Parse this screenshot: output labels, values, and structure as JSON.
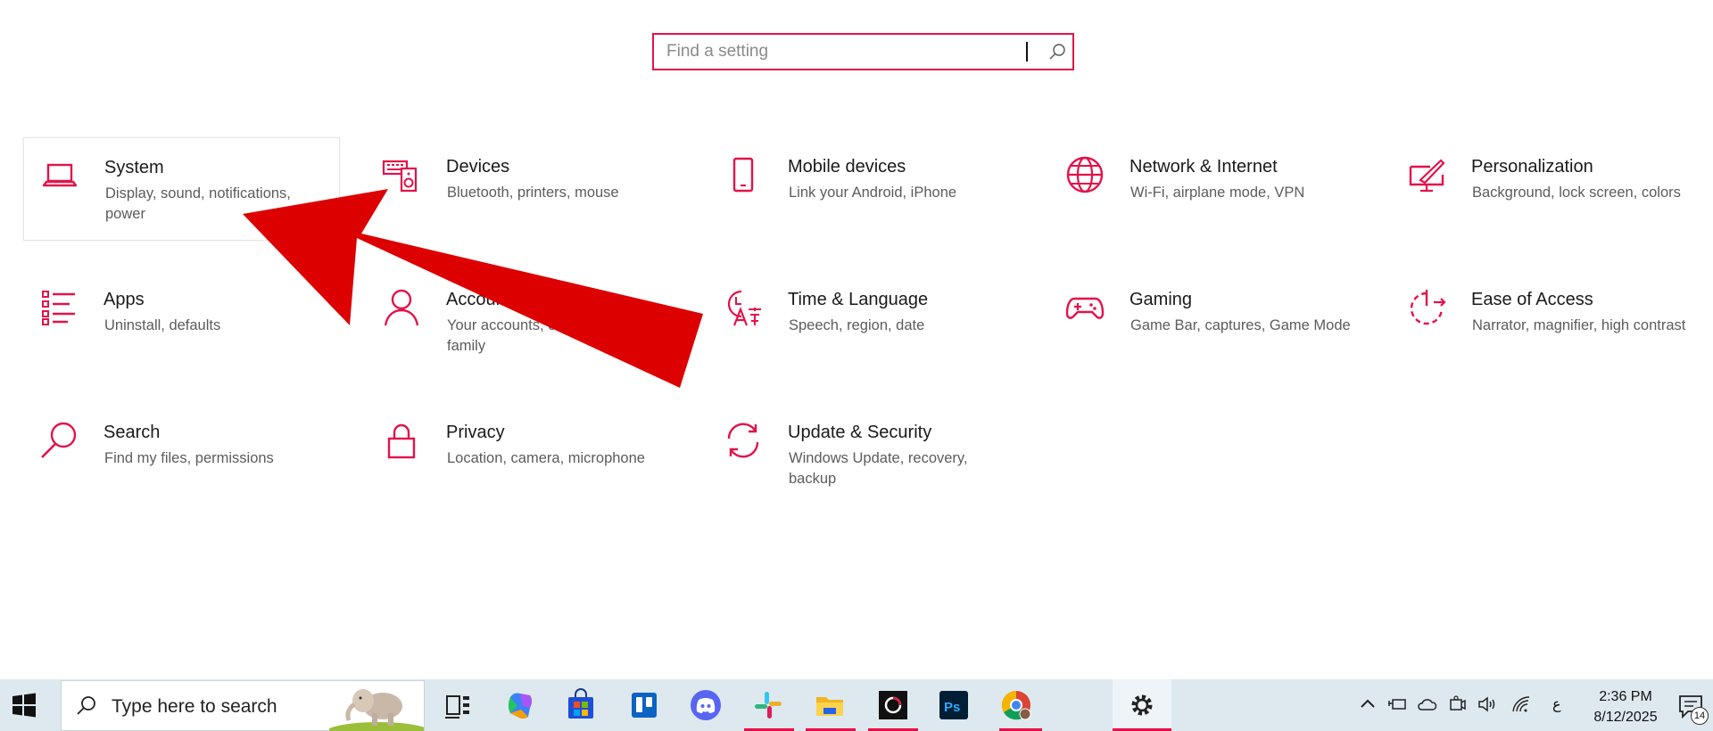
{
  "search": {
    "placeholder": "Find a setting",
    "value": ""
  },
  "categories": [
    {
      "title": "System",
      "desc": "Display, sound, notifications, power",
      "icon": "laptop-icon"
    },
    {
      "title": "Devices",
      "desc": "Bluetooth, printers, mouse",
      "icon": "devices-icon"
    },
    {
      "title": "Mobile devices",
      "desc": "Link your Android, iPhone",
      "icon": "phone-icon"
    },
    {
      "title": "Network & Internet",
      "desc": "Wi-Fi, airplane mode, VPN",
      "icon": "globe-icon"
    },
    {
      "title": "Personalization",
      "desc": "Background, lock screen, colors",
      "icon": "paintbrush-icon"
    },
    {
      "title": "Apps",
      "desc": "Uninstall, defaults",
      "icon": "apps-list-icon"
    },
    {
      "title": "Accounts",
      "desc": "Your accounts, email, sync, work, family",
      "icon": "person-icon"
    },
    {
      "title": "Time & Language",
      "desc": "Speech, region, date",
      "icon": "time-language-icon"
    },
    {
      "title": "Gaming",
      "desc": "Game Bar, captures, Game Mode",
      "icon": "gamepad-icon"
    },
    {
      "title": "Ease of Access",
      "desc": "Narrator, magnifier, high contrast",
      "icon": "ease-of-access-icon"
    },
    {
      "title": "Search",
      "desc": "Find my files, permissions",
      "icon": "search-icon"
    },
    {
      "title": "Privacy",
      "desc": "Location, camera, microphone",
      "icon": "lock-icon"
    },
    {
      "title": "Update & Security",
      "desc": "Windows Update, recovery, backup",
      "icon": "sync-icon"
    }
  ],
  "taskbar": {
    "search_placeholder": "Type here to search",
    "apps": [
      "task-view-icon",
      "copilot-icon",
      "store-icon",
      "trello-icon",
      "discord-icon",
      "slack-icon",
      "file-explorer-icon",
      "media-app-icon",
      "photoshop-icon",
      "chrome-icon",
      "settings-icon"
    ],
    "tray_lang": "ع",
    "time": "2:36 PM",
    "date": "8/12/2025",
    "notification_count": "14"
  },
  "colors": {
    "accent": "#e3124a",
    "arrow": "#dd0000",
    "taskbar": "#dde9ef"
  }
}
